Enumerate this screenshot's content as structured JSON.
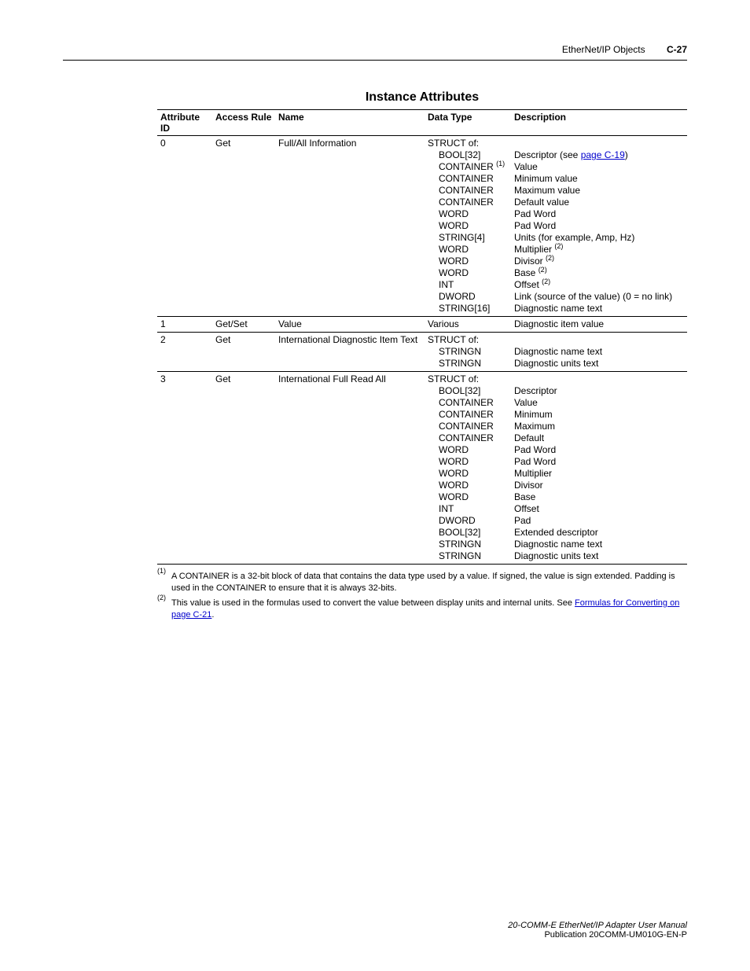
{
  "header": {
    "section": "EtherNet/IP Objects",
    "page": "C-27"
  },
  "title": "Instance Attributes",
  "columns": {
    "c1": "Attribute ID",
    "c2": "Access Rule",
    "c3": "Name",
    "c4": "Data Type",
    "c5": "Description"
  },
  "rows": {
    "r0": {
      "id": "0",
      "rule": "Get",
      "name": "Full/All Information",
      "type_head": "STRUCT of:",
      "types": [
        "BOOL[32]",
        "CONTAINER ",
        "CONTAINER",
        "CONTAINER",
        "CONTAINER",
        "WORD",
        "WORD",
        "STRING[4]",
        "WORD",
        "WORD",
        "WORD",
        "INT",
        "DWORD",
        "STRING[16]"
      ],
      "type_sup": {
        "1": "(1)"
      },
      "descs_pre": "",
      "descs": [
        "Descriptor (see ",
        ")",
        "Value",
        "Minimum value",
        "Maximum value",
        "Default value",
        "Pad Word",
        "Pad Word",
        "Units (for example, Amp, Hz)",
        "Multiplier ",
        "Divisor ",
        "Base ",
        "Offset ",
        "Link (source of the value) (0 = no link)",
        "Diagnostic name text"
      ],
      "link_c19": "page C-19",
      "sup2a": "(2)",
      "sup2b": "(2)",
      "sup2c": "(2)",
      "sup2d": "(2)"
    },
    "r1": {
      "id": "1",
      "rule": "Get/Set",
      "name": "Value",
      "type": "Various",
      "desc": "Diagnostic item value"
    },
    "r2": {
      "id": "2",
      "rule": "Get",
      "name": "International Diagnostic Item Text",
      "type_head": "STRUCT of:",
      "types": [
        "STRINGN",
        "STRINGN"
      ],
      "descs": [
        "",
        "Diagnostic name text",
        "Diagnostic units text"
      ]
    },
    "r3": {
      "id": "3",
      "rule": "Get",
      "name": "International Full Read All",
      "type_head": "STRUCT of:",
      "types": [
        "BOOL[32]",
        "CONTAINER",
        "CONTAINER",
        "CONTAINER",
        "CONTAINER",
        "WORD",
        "WORD",
        "WORD",
        "WORD",
        "WORD",
        "INT",
        "DWORD",
        "BOOL[32]",
        "STRINGN",
        "STRINGN"
      ],
      "descs": [
        "",
        "Descriptor",
        "Value",
        "Minimum",
        "Maximum",
        "Default",
        "Pad Word",
        "Pad Word",
        "Multiplier",
        "Divisor",
        "Base",
        "Offset",
        "Pad",
        "Extended descriptor",
        "Diagnostic name text",
        "Diagnostic units text"
      ]
    }
  },
  "footnotes": {
    "f1_num": "(1)",
    "f1_text": "A CONTAINER is a 32-bit block of data that contains the data type used by a value. If signed, the value is sign extended. Padding is used in the CONTAINER to ensure that it is always 32-bits.",
    "f2_num": "(2)",
    "f2_text_a": "This value is used in the formulas used to convert the value between display units and internal units. See ",
    "f2_link": "Formulas for Converting on page C-21",
    "f2_text_b": "."
  },
  "footer": {
    "manual": "20-COMM-E EtherNet/IP Adapter User Manual",
    "pub": "Publication 20COMM-UM010G-EN-P"
  }
}
